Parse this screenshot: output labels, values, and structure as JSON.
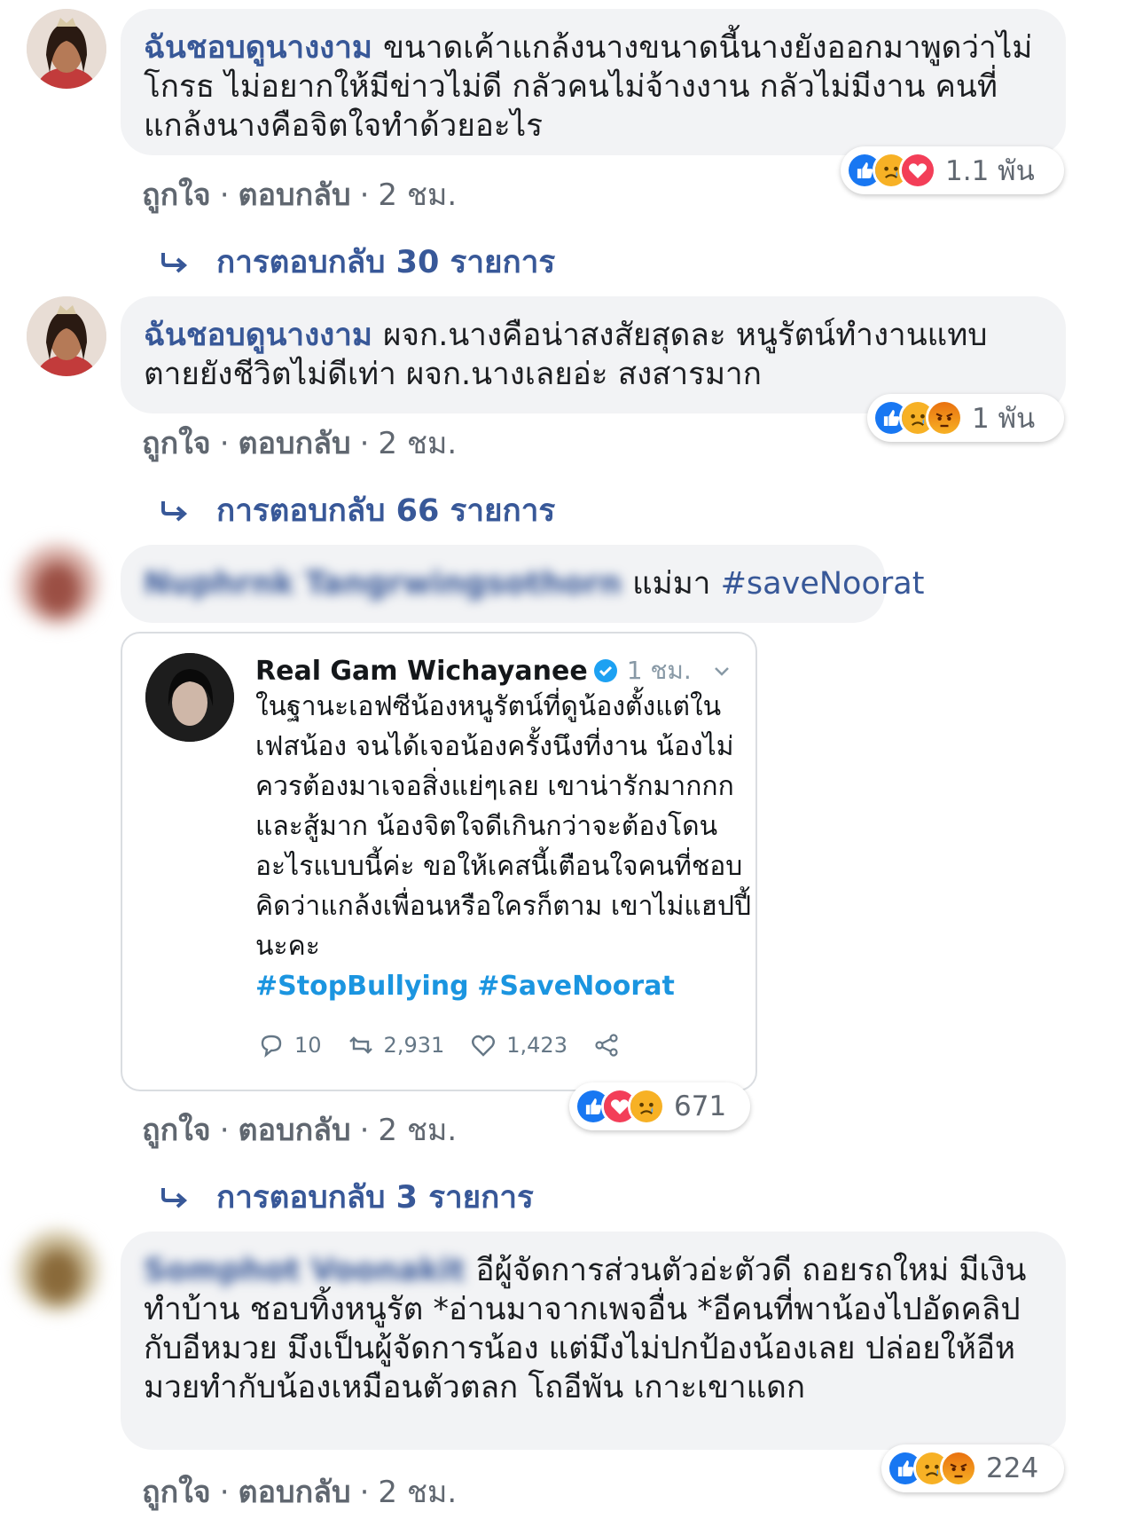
{
  "comments": [
    {
      "author": "ฉันชอบดูนางงาม",
      "text": "ขนาดเค้าแกล้งนางขนาดนี้นางยังออกมาพูดว่าไม่โกรธ ไม่อยากให้มีข่าวไม่ดี กลัวคนไม่จ้างงาน กลัวไม่มีงาน คนที่แกล้งนางคือจิตใจทำด้วยอะไร",
      "reaction_count": "1.1 พัน",
      "reactions": [
        "like-icon",
        "sad-icon",
        "love-icon"
      ],
      "like_label": "ถูกใจ",
      "reply_label": "ตอบกลับ",
      "time": "2 ชม.",
      "replies": "การตอบกลับ 30 รายการ"
    },
    {
      "author": "ฉันชอบดูนางงาม",
      "text": "ผจก.นางคือน่าสงสัยสุดละ หนูรัตน์ทำงานแทบตายยังชีวิตไม่ดีเท่า ผจก.นางเลยอ่ะ สงสารมาก",
      "reaction_count": "1 พัน",
      "reactions": [
        "like-icon",
        "sad-icon",
        "angry-icon"
      ],
      "like_label": "ถูกใจ",
      "reply_label": "ตอบกลับ",
      "time": "2 ชม.",
      "replies": "การตอบกลับ 66 รายการ"
    },
    {
      "author": "Nuphrnk Tangrwingsothorn",
      "text": "แม่มา",
      "hashtag": "#saveNoorat",
      "reaction_count": "671",
      "reactions": [
        "like-icon",
        "love-icon",
        "sad-icon"
      ],
      "like_label": "ถูกใจ",
      "reply_label": "ตอบกลับ",
      "time": "2 ชม.",
      "replies": "การตอบกลับ 3 รายการ"
    },
    {
      "author": "Somphot Voonakit",
      "text": "อีผู้จัดการส่วนตัวอ่ะตัวดี ถอยรถใหม่ มีเงินทำบ้าน ชอบทิ้งหนูรัต *อ่านมาจากเพจอื่น *อีคนที่พาน้องไปอัดคลิปกับอีหมวย มึงเป็นผู้จัดการน้อง แต่มึงไม่ปกป้องน้องเลย ปล่อยให้อีหมวยทำกับน้องเหมือนตัวตลก โถอีพัน เกาะเขาแดก",
      "reaction_count": "224",
      "reactions": [
        "like-icon",
        "sad-icon",
        "angry-icon"
      ],
      "like_label": "ถูกใจ",
      "reply_label": "ตอบกลับ",
      "time": "2 ชม."
    }
  ],
  "tweet": {
    "name": "Real Gam Wichayanee",
    "time": "1 ชม.",
    "text": "ในฐานะเอฟซีน้องหนูรัตน์ที่ดูน้องตั้งแต่ในเฟสน้อง จนได้เจอน้องครั้งนึงที่งาน น้องไม่ควรต้องมาเจอสิ่งแย่ๆเลย เขาน่ารักมากกกและสู้มาก น้องจิตใจดีเกินกว่าจะต้องโดนอะไรแบบนี้ค่ะ ขอให้เคสนี้เตือนใจคนที่ชอบคิดว่าแกล้งเพื่อนหรือใครก็ตาม เขาไม่แฮปปี้นะคะ",
    "tags": [
      "#StopBullying",
      "#SaveNoorat"
    ],
    "replies": "10",
    "retweets": "2,931",
    "likes": "1,423"
  },
  "colors": {
    "link": "#385898",
    "bubble": "#f2f3f5",
    "meta": "#606770",
    "like_blue": "#1877f2",
    "love_red": "#f33e58",
    "sad_yellow": "#f7b125",
    "angry_orange": "#e9710f",
    "twitter_blue": "#1b95e0"
  }
}
